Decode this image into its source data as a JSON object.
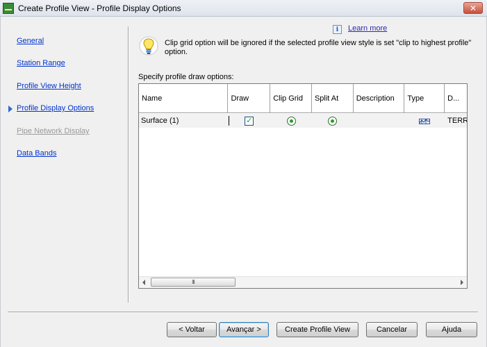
{
  "window": {
    "title": "Create Profile View - Profile Display Options",
    "close_label": "✕"
  },
  "nav": {
    "items": [
      {
        "label": "General",
        "state": "link"
      },
      {
        "label": "Station Range",
        "state": "link"
      },
      {
        "label": "Profile View Height",
        "state": "link"
      },
      {
        "label": "Profile Display Options",
        "state": "current"
      },
      {
        "label": "Pipe Network Display",
        "state": "disabled"
      },
      {
        "label": "Data Bands",
        "state": "link"
      }
    ]
  },
  "help": {
    "learn_more": "Learn more",
    "info_icon_glyph": "i"
  },
  "note": {
    "text": "Clip grid option will be ignored if the selected profile view style is set \"clip to highest profile\" option."
  },
  "grid": {
    "caption": "Specify profile draw options:",
    "columns": [
      "Name",
      "Draw",
      "Clip Grid",
      "Split At",
      "Description",
      "Type",
      "D..."
    ],
    "rows": [
      {
        "name": "Surface (1)",
        "draw": true,
        "clip_grid": true,
        "split_at": true,
        "description": "",
        "type_icon": "surface-profile-icon",
        "d": "TERRE"
      }
    ],
    "scroll_thumb_glyph": "III"
  },
  "buttons": {
    "back": "< Voltar",
    "next": "Avançar >",
    "create": "Create Profile View",
    "cancel": "Cancelar",
    "help": "Ajuda"
  },
  "colors": {
    "link": "#0033cc",
    "disabled": "#9a9a9a",
    "current_arrow": "#2d6bd6"
  }
}
